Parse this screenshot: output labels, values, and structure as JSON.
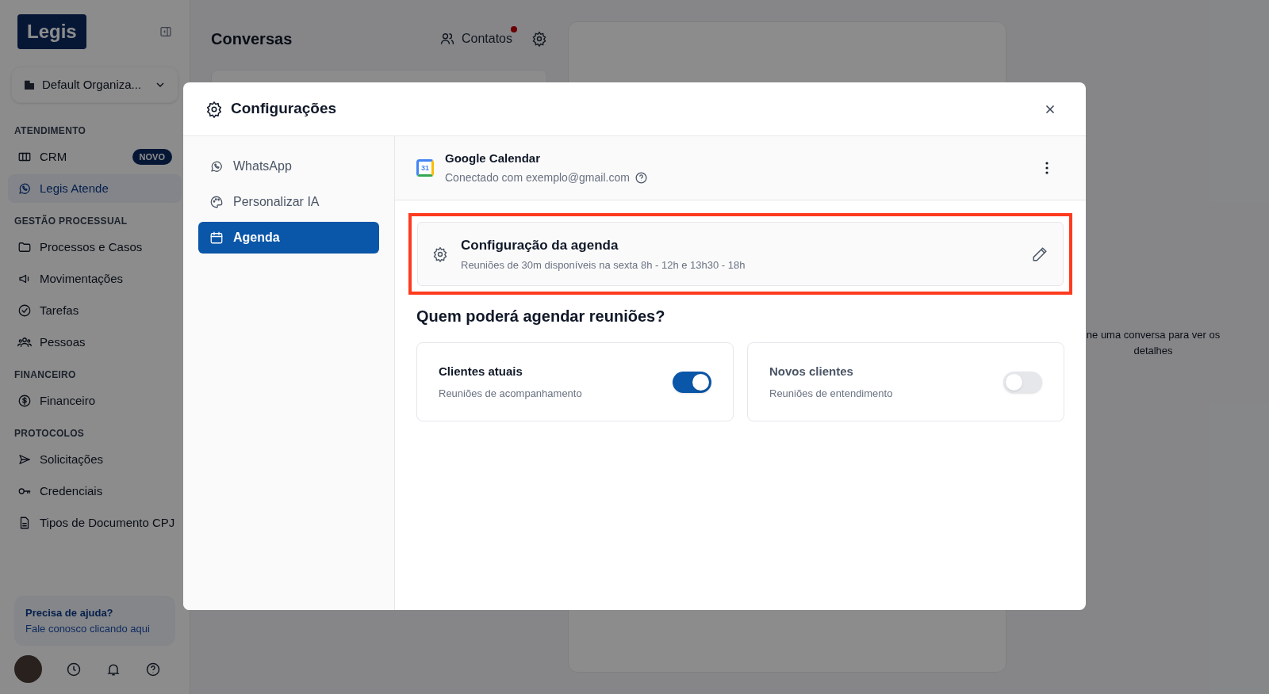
{
  "sidebar": {
    "logo": "Legis",
    "organization": "Default Organiza...",
    "sections": [
      {
        "title": "ATENDIMENTO",
        "items": [
          {
            "label": "CRM",
            "badge": "NOVO",
            "selected": false
          },
          {
            "label": "Legis Atende",
            "selected": true
          }
        ]
      },
      {
        "title": "GESTÃO PROCESSUAL",
        "items": [
          {
            "label": "Processos e Casos",
            "selected": false
          },
          {
            "label": "Movimentações",
            "selected": false
          },
          {
            "label": "Tarefas",
            "selected": false
          },
          {
            "label": "Pessoas",
            "selected": false
          }
        ]
      },
      {
        "title": "FINANCEIRO",
        "items": [
          {
            "label": "Financeiro",
            "selected": false
          }
        ]
      },
      {
        "title": "PROTOCOLOS",
        "items": [
          {
            "label": "Solicitações",
            "selected": false
          },
          {
            "label": "Credenciais",
            "selected": false
          },
          {
            "label": "Tipos de Documento CPJ",
            "selected": false
          }
        ]
      }
    ],
    "help": {
      "title": "Precisa de ajuda?",
      "link": "Fale conosco clicando aqui"
    }
  },
  "conversations": {
    "title": "Conversas",
    "contacts": "Contatos",
    "contacts_notification": true
  },
  "details_panel": {
    "empty_text": "ne uma conversa para ver os detalhes"
  },
  "modal": {
    "title": "Configurações",
    "nav": [
      {
        "label": "WhatsApp",
        "selected": false
      },
      {
        "label": "Personalizar IA",
        "selected": false
      },
      {
        "label": "Agenda",
        "selected": true
      }
    ],
    "integration": {
      "name": "Google Calendar",
      "status": "Conectado com exemplo@gmail.com",
      "calendar_day": "31"
    },
    "schedule_card": {
      "title": "Configuração da agenda",
      "subtitle": "Reuniões de 30m disponíveis na sexta 8h - 12h e 13h30 - 18h",
      "highlighted": true
    },
    "question": "Quem poderá agendar reuniões?",
    "options": [
      {
        "title": "Clientes atuais",
        "description": "Reuniões de acompanhamento",
        "on": true
      },
      {
        "title": "Novos clientes",
        "description": "Reuniões de entendimento",
        "on": false
      }
    ]
  }
}
